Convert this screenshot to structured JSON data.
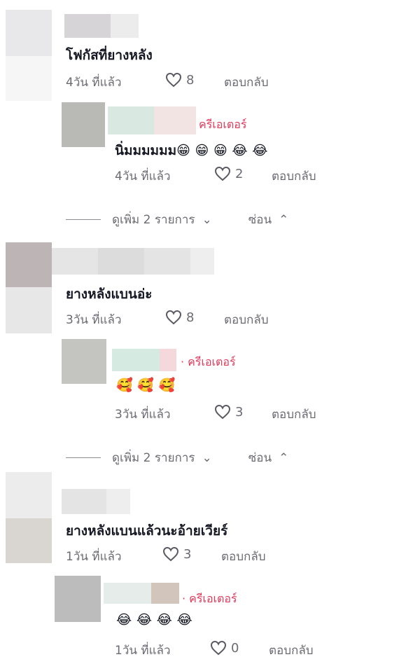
{
  "comments": [
    {
      "text": "โฟกัสที่ยางหลัง",
      "time": "4วัน ที่แล้ว",
      "likes": "8",
      "reply": "ตอบกลับ",
      "replies": [
        {
          "creator": "ครีเอเตอร์",
          "text": "นิ่มมมมมม😁 😁 😁 😂 😂",
          "time": "4วัน ที่แล้ว",
          "likes": "2",
          "reply": "ตอบกลับ"
        }
      ],
      "more": "ดูเพิ่ม 2 รายการ",
      "hide": "ซ่อน"
    },
    {
      "text": "ยางหลังแบนอ่ะ",
      "time": "3วัน ที่แล้ว",
      "likes": "8",
      "reply": "ตอบกลับ",
      "replies": [
        {
          "creator": "· ครีเอเตอร์",
          "text": "🥰 🥰 🥰",
          "time": "3วัน ที่แล้ว",
          "likes": "3",
          "reply": "ตอบกลับ"
        }
      ],
      "more": "ดูเพิ่ม 2 รายการ",
      "hide": "ซ่อน"
    },
    {
      "text": "ยางหลังแบนแล้วนะอ้ายเวียร์",
      "time": "1วัน ที่แล้ว",
      "likes": "3",
      "reply": "ตอบกลับ",
      "replies": [
        {
          "creator": "· ครีเอเตอร์",
          "text": "😂 😂 😂 😂",
          "time": "1วัน ที่แล้ว",
          "likes": "0",
          "reply": "ตอบกลับ"
        }
      ]
    }
  ],
  "colors": {
    "accent": "#e0395a",
    "muted": "#6b6b73",
    "text": "#161823"
  }
}
